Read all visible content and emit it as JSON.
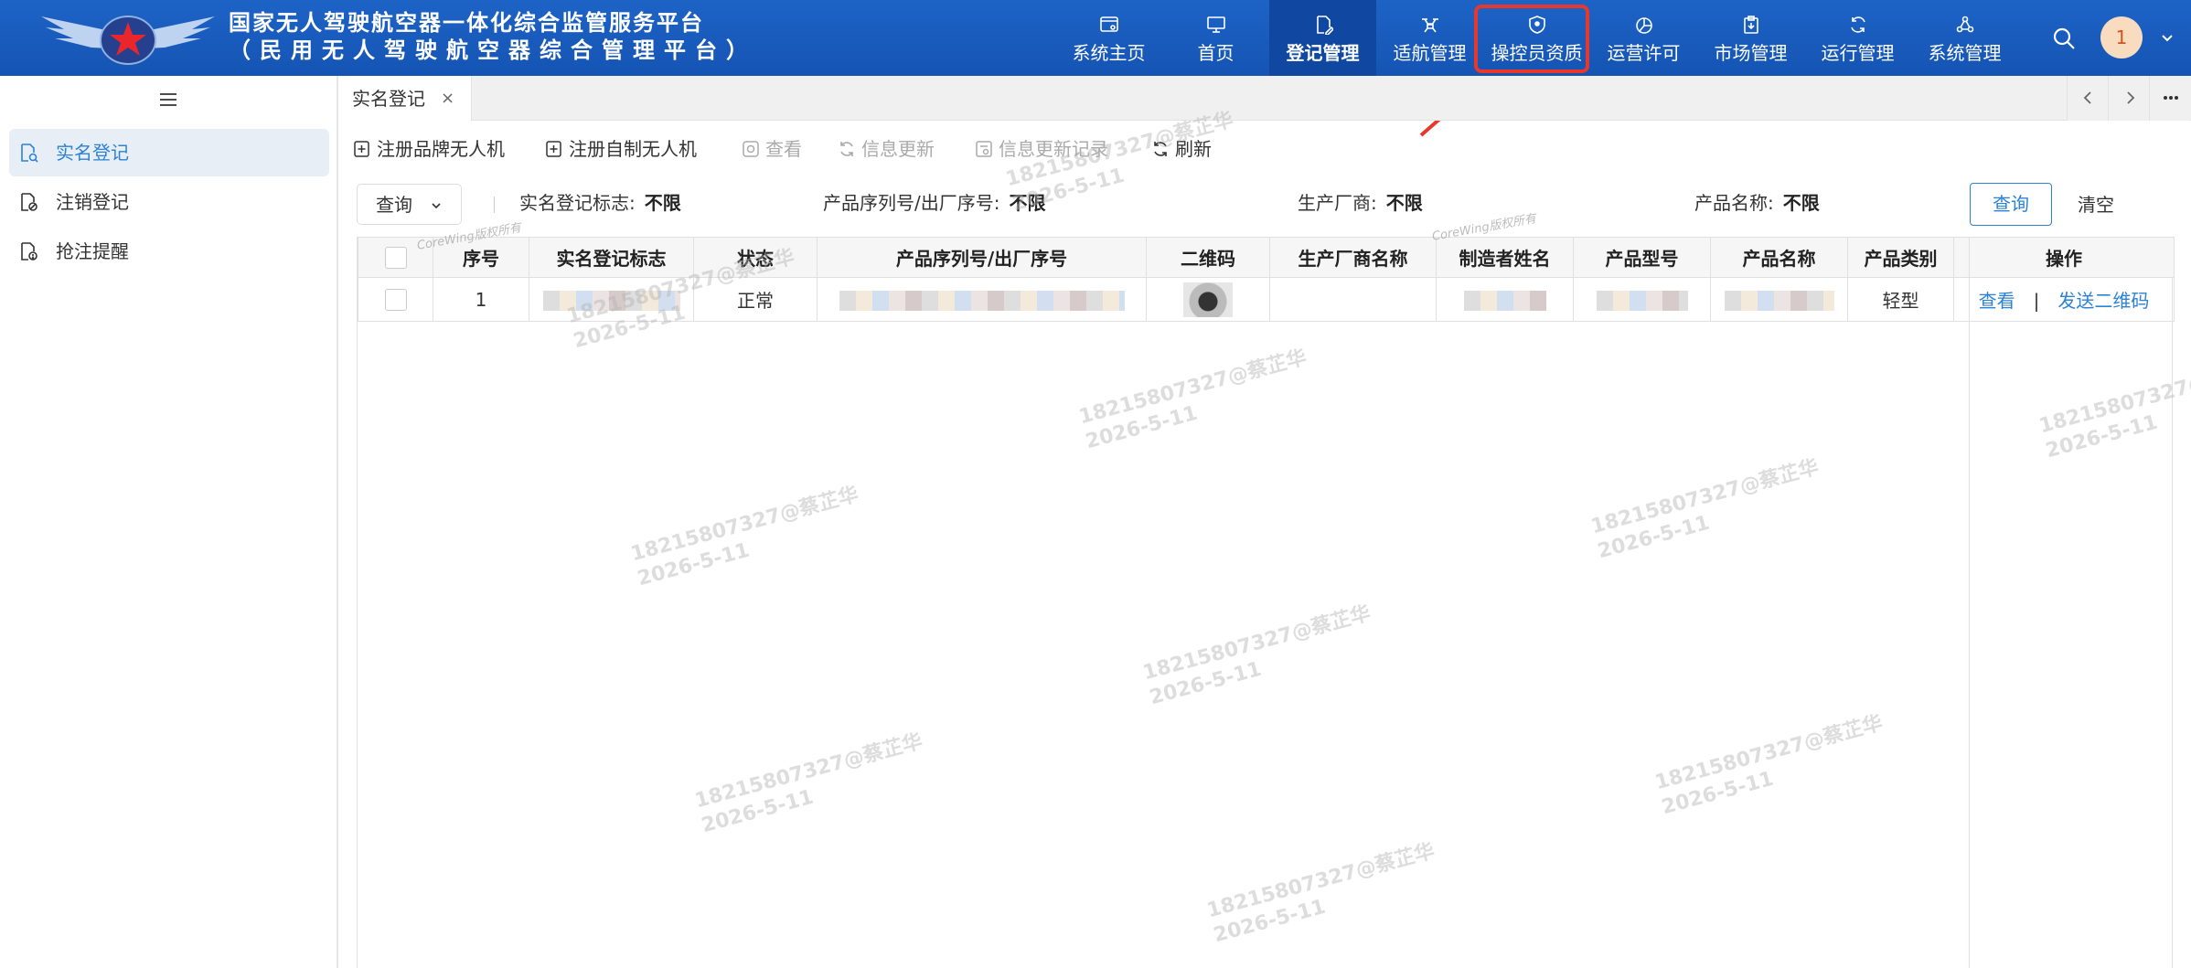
{
  "header": {
    "title": "国家无人驾驶航空器一体化综合监管服务平台",
    "subtitle": "（民用无人驾驶航空器综合管理平台）",
    "nav": [
      {
        "label": "系统主页",
        "icon": "window-icon"
      },
      {
        "label": "首页",
        "icon": "monitor-icon"
      },
      {
        "label": "登记管理",
        "icon": "document-edit-icon",
        "active": true
      },
      {
        "label": "适航管理",
        "icon": "drone-icon"
      },
      {
        "label": "操控员资质",
        "icon": "shield-icon",
        "highlighted": true
      },
      {
        "label": "运营许可",
        "icon": "pie-chart-icon"
      },
      {
        "label": "市场管理",
        "icon": "clipboard-icon"
      },
      {
        "label": "运行管理",
        "icon": "cycle-icon"
      },
      {
        "label": "系统管理",
        "icon": "network-icon"
      }
    ],
    "avatar_text": "1",
    "colors": {
      "header_bg": "#1554b3",
      "active_nav": "#0f47a1",
      "highlight": "#e8382c",
      "accent": "#2c82d6"
    }
  },
  "sidebar": {
    "items": [
      {
        "label": "实名登记",
        "active": true
      },
      {
        "label": "注销登记"
      },
      {
        "label": "抢注提醒"
      }
    ]
  },
  "tabs": [
    {
      "label": "实名登记",
      "close": "×"
    }
  ],
  "toolbar": {
    "register_brand": "注册品牌无人机",
    "register_custom": "注册自制无人机",
    "view": "查看",
    "info_update": "信息更新",
    "update_records": "信息更新记录",
    "refresh": "刷新"
  },
  "filters": {
    "query_dropdown": "查询",
    "items": [
      {
        "label": "实名登记标志:",
        "value": "不限"
      },
      {
        "label": "产品序列号/出厂序号:",
        "value": "不限"
      },
      {
        "label": "生产厂商:",
        "value": "不限"
      },
      {
        "label": "产品名称:",
        "value": "不限"
      }
    ],
    "query_button": "查询",
    "clear_button": "清空"
  },
  "table": {
    "columns": [
      "序号",
      "实名登记标志",
      "状态",
      "产品序列号/出厂序号",
      "二维码",
      "生产厂商名称",
      "制造者姓名",
      "产品型号",
      "产品名称",
      "产品类别",
      "操作"
    ],
    "rows": [
      {
        "index": "1",
        "status": "正常",
        "category": "轻型",
        "op_view": "查看",
        "op_sep": "|",
        "op_send": "发送二维码"
      }
    ]
  },
  "watermark": {
    "text": "18215807327@蔡芷华\n2026-5-11",
    "copyright": "CoreWing版权所有"
  }
}
